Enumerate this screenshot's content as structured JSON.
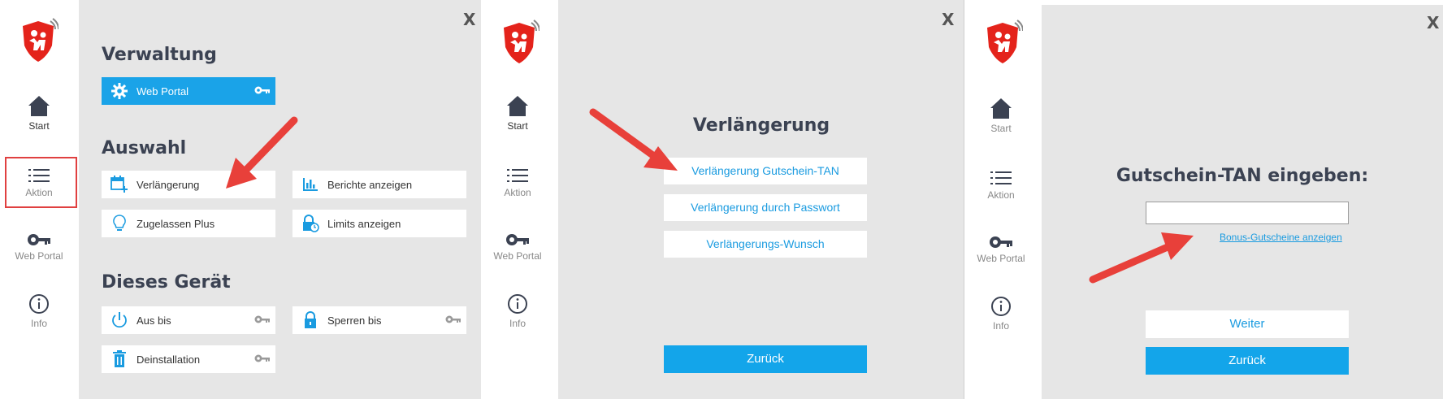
{
  "panel1": {
    "sidebar": {
      "items": [
        {
          "label": "Start",
          "icon": "home-icon"
        },
        {
          "label": "Aktion",
          "icon": "list-icon"
        },
        {
          "label": "Web Portal",
          "icon": "key-icon"
        },
        {
          "label": "Info",
          "icon": "info-icon"
        }
      ]
    },
    "close_label": "X",
    "sections": {
      "verwaltung": {
        "title": "Verwaltung",
        "tiles": [
          {
            "label": "Web Portal"
          }
        ]
      },
      "auswahl": {
        "title": "Auswahl",
        "tiles": [
          {
            "label": "Verlängerung"
          },
          {
            "label": "Berichte anzeigen"
          },
          {
            "label": "Zugelassen Plus"
          },
          {
            "label": "Limits anzeigen"
          }
        ]
      },
      "geraet": {
        "title": "Dieses Gerät",
        "tiles": [
          {
            "label": "Aus bis"
          },
          {
            "label": "Sperren bis"
          },
          {
            "label": "Deinstallation"
          }
        ]
      }
    }
  },
  "panel2": {
    "sidebar": {
      "items": [
        {
          "label": "Start"
        },
        {
          "label": "Aktion"
        },
        {
          "label": "Web Portal"
        },
        {
          "label": "Info"
        }
      ]
    },
    "close_label": "X",
    "title": "Verlängerung",
    "options": [
      {
        "label": "Verlängerung Gutschein-TAN"
      },
      {
        "label": "Verlängerung durch Passwort"
      },
      {
        "label": "Verlängerungs-Wunsch"
      }
    ],
    "back_label": "Zurück"
  },
  "panel3": {
    "sidebar": {
      "items": [
        {
          "label": "Start"
        },
        {
          "label": "Aktion"
        },
        {
          "label": "Web Portal"
        },
        {
          "label": "Info"
        }
      ]
    },
    "close_label": "X",
    "title": "Gutschein-TAN eingeben:",
    "input_value": "",
    "link_label": "Bonus-Gutscheine anzeigen",
    "next_label": "Weiter",
    "back_label": "Zurück"
  },
  "colors": {
    "accent": "#1aa3e8",
    "arrow": "#e8403a",
    "sidebar_bg": "#ffffff",
    "content_bg": "#e6e6e6",
    "heading": "#3b4252"
  }
}
